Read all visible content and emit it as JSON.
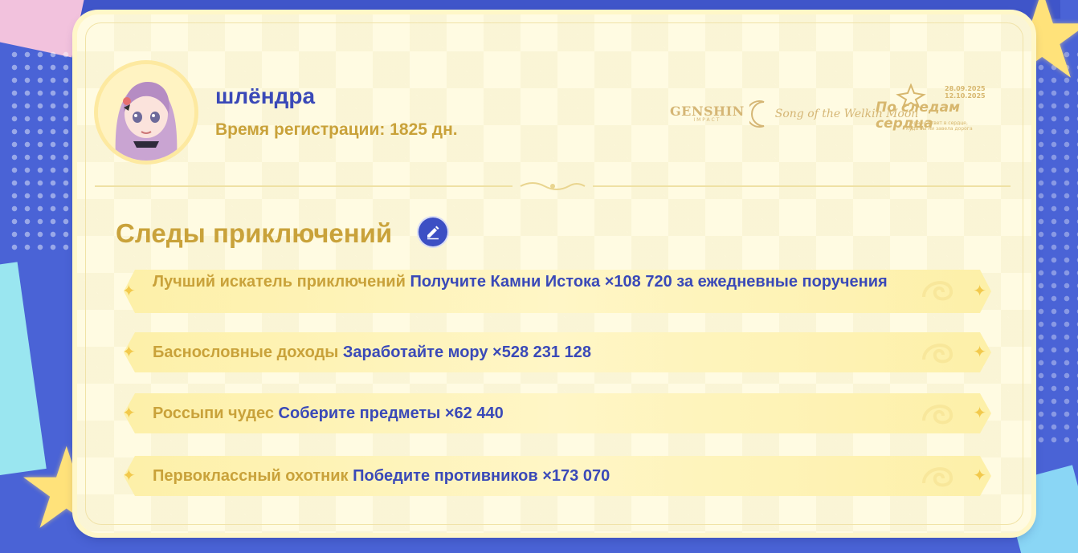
{
  "profile": {
    "username": "шлёндра",
    "registration": "Время регистрации: 1825 дн."
  },
  "logos": {
    "genshin": "GENSHIN",
    "genshin_sub": "IMPACT",
    "song": "Song of the Welkin Moon",
    "event_title": "По следам сердца",
    "event_dates": [
      "28.09.2025",
      "12.10.2025"
    ],
    "event_slogan": [
      "Храни ответ в сердце,",
      "куда бы ни завела дорога"
    ]
  },
  "section": {
    "title": "Следы приключений",
    "edit_icon": "pencil-icon"
  },
  "achievements": [
    {
      "name": "Лучший искатель приключений",
      "desc": "Получите Камни Истока ×108 720 за ежедневные поручения"
    },
    {
      "name": "Баснословные доходы",
      "desc": "Заработайте мору ×528 231 128"
    },
    {
      "name": "Россыпи чудес",
      "desc": "Соберите предметы ×62 440"
    },
    {
      "name": "Первоклассный охотник",
      "desc": "Победите противников ×173 070"
    }
  ],
  "colors": {
    "accent_blue": "#3a49b8",
    "accent_gold": "#c9a23a",
    "card_bg": "#fffbe2",
    "page_bg": "#4a63d6"
  }
}
